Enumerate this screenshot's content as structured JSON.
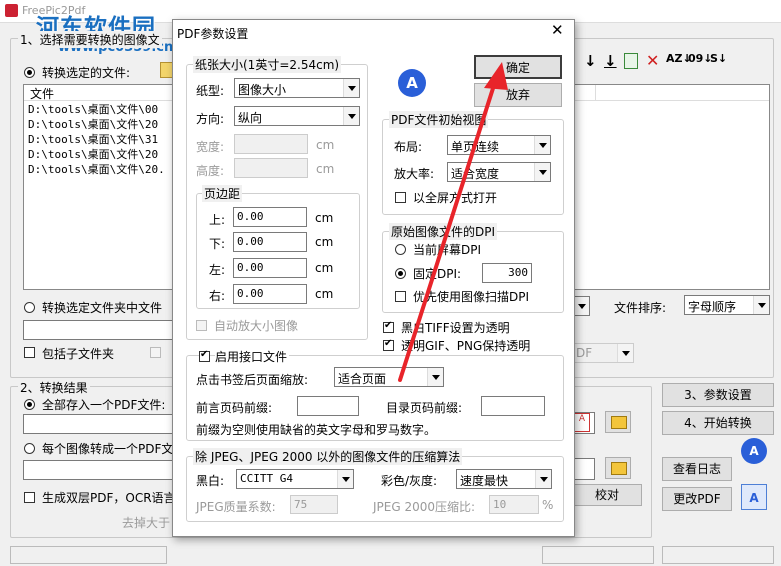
{
  "main": {
    "title": "FreePic2Pdf",
    "watermark_line1": "河东软件园",
    "watermark_line2": "www.pc0359.cn",
    "section1_label": "1、选择需要转换的图像文",
    "radio_convert_files": "转换选定的文件:",
    "file_list_header": "文件",
    "files": [
      "D:\\tools\\桌面\\文件\\00",
      "D:\\tools\\桌面\\文件\\20",
      "D:\\tools\\桌面\\文件\\31",
      "D:\\tools\\桌面\\文件\\20",
      "D:\\tools\\桌面\\文件\\20."
    ],
    "radio_convert_folder": "转换选定文件夹中文件",
    "chk_subfolders": "包括子文件夹",
    "sort_label": "文件排序:",
    "sort_value": "字母顺序",
    "section2_label": "2、转换结果",
    "radio_save_one": "全部存入一个PDF文件:",
    "radio_each": "每个图像转成一个PDF文",
    "chk_dual_layer": "生成双层PDF，OCR语言",
    "remove_text": "去掉大于",
    "btn_params": "3、参数设置",
    "btn_start": "4、开始转换",
    "btn_view_log": "查看日志",
    "btn_modify_pdf": "更改PDF",
    "btn_proofread": "校对"
  },
  "dialog": {
    "title": "PDF参数设置",
    "paper_group": "纸张大小(1英寸=2.54cm)",
    "paper_type_label": "纸型:",
    "paper_type_value": "图像大小",
    "orientation_label": "方向:",
    "orientation_value": "纵向",
    "width_label": "宽度:",
    "height_label": "高度:",
    "unit_cm": "cm",
    "margin_group": "页边距",
    "margin_top_label": "上:",
    "margin_top": "0.00",
    "margin_bottom_label": "下:",
    "margin_bottom": "0.00",
    "margin_left_label": "左:",
    "margin_left": "0.00",
    "margin_right_label": "右:",
    "margin_right": "0.00",
    "auto_enlarge": "自动放大小图像",
    "btn_ok": "确定",
    "btn_cancel": "放弃",
    "view_group": "PDF文件初始视图",
    "layout_label": "布局:",
    "layout_value": "单页连续",
    "zoom_label": "放大率:",
    "zoom_value": "适合宽度",
    "fullscreen": "以全屏方式打开",
    "dpi_group": "原始图像文件的DPI",
    "dpi_screen": "当前屏幕DPI",
    "dpi_fixed": "固定DPI:",
    "dpi_fixed_value": "300",
    "dpi_scan": "优先使用图像扫描DPI",
    "tiff_transparent": "黑白TIFF设置为透明",
    "gif_png_transparent": "透明GIF、PNG保持透明",
    "enable_interface": "启用接口文件",
    "bookmark_zoom_label": "点击书签后页面缩放:",
    "bookmark_zoom_value": "适合页面",
    "front_prefix_label": "前言页码前缀:",
    "toc_prefix_label": "目录页码前缀:",
    "prefix_note": "前缀为空则使用缺省的英文字母和罗马数字。",
    "compress_group": "除 JPEG、JPEG 2000 以外的图像文件的压缩算法",
    "bw_label": "黑白:",
    "bw_value": "CCITT G4",
    "color_label": "彩色/灰度:",
    "color_value": "速度最快",
    "jpeg_quality_label": "JPEG质量系数:",
    "jpeg_quality_value": "75",
    "jpeg2000_label": "JPEG 2000压缩比:",
    "jpeg2000_value": "10",
    "percent": "%"
  },
  "colors": {
    "arrow": "#e8242a",
    "watermark": "#1a6fc0",
    "accent_blue": "#1e4fd0"
  }
}
